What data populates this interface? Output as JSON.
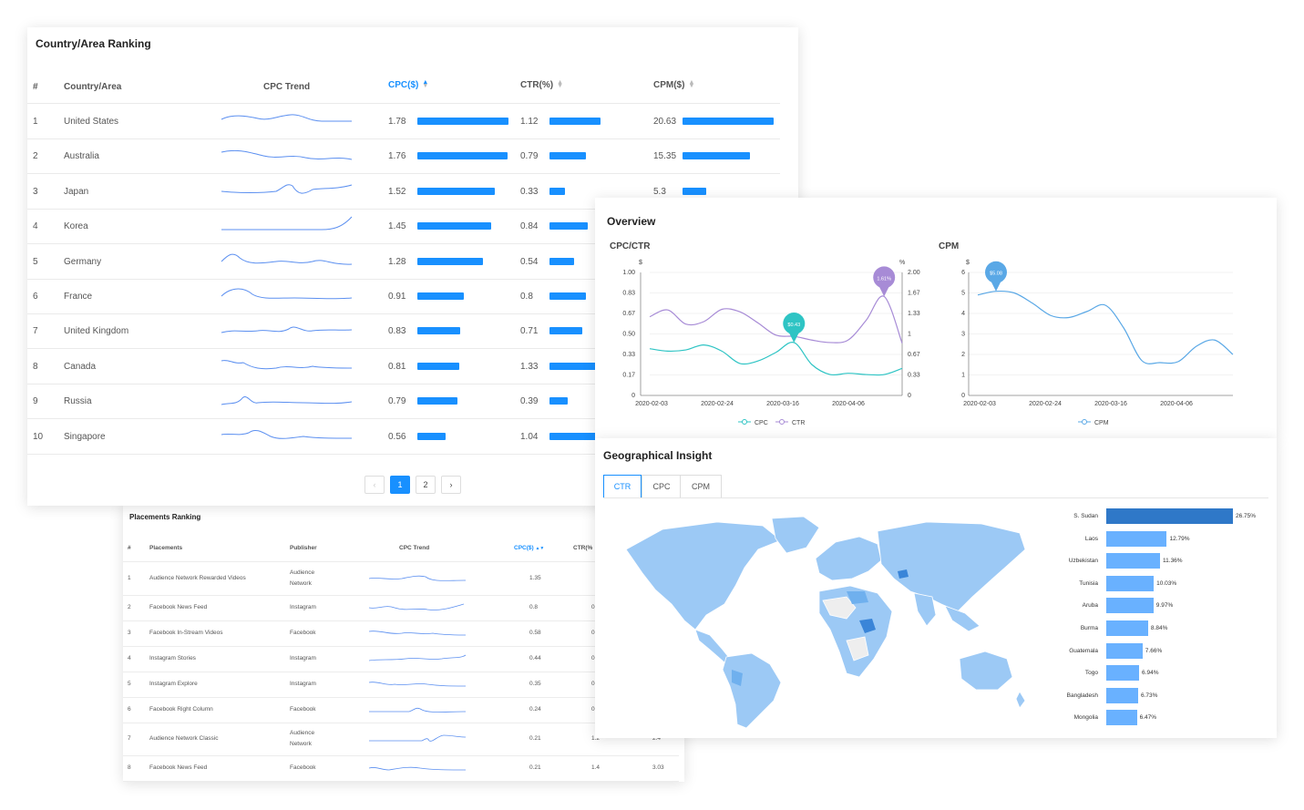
{
  "country_ranking": {
    "title": "Country/Area Ranking",
    "headers": {
      "num": "#",
      "country": "Country/Area",
      "trend": "CPC Trend",
      "cpc": "CPC($)",
      "ctr": "CTR(%)",
      "cpm": "CPM($)"
    },
    "rows": [
      {
        "rank": "1",
        "country": "United States",
        "cpc": "1.78",
        "ctr": "1.12",
        "cpm": "20.63"
      },
      {
        "rank": "2",
        "country": "Australia",
        "cpc": "1.76",
        "ctr": "0.79",
        "cpm": "15.35"
      },
      {
        "rank": "3",
        "country": "Japan",
        "cpc": "1.52",
        "ctr": "0.33",
        "cpm": "5.3"
      },
      {
        "rank": "4",
        "country": "Korea",
        "cpc": "1.45",
        "ctr": "0.84",
        "cpm": ""
      },
      {
        "rank": "5",
        "country": "Germany",
        "cpc": "1.28",
        "ctr": "0.54",
        "cpm": ""
      },
      {
        "rank": "6",
        "country": "France",
        "cpc": "0.91",
        "ctr": "0.8",
        "cpm": ""
      },
      {
        "rank": "7",
        "country": "United Kingdom",
        "cpc": "0.83",
        "ctr": "0.71",
        "cpm": ""
      },
      {
        "rank": "8",
        "country": "Canada",
        "cpc": "0.81",
        "ctr": "1.33",
        "cpm": ""
      },
      {
        "rank": "9",
        "country": "Russia",
        "cpc": "0.79",
        "ctr": "0.39",
        "cpm": ""
      },
      {
        "rank": "10",
        "country": "Singapore",
        "cpc": "0.56",
        "ctr": "1.04",
        "cpm": ""
      }
    ],
    "pagination": {
      "prev": "‹",
      "page1": "1",
      "page2": "2",
      "next": "›"
    }
  },
  "placements_ranking": {
    "title": "Placements Ranking",
    "headers": {
      "num": "#",
      "placement": "Placements",
      "publisher": "Publisher",
      "trend": "CPC Trend",
      "cpc": "CPC($)",
      "ctr": "CTR(%"
    },
    "rows": [
      {
        "rank": "1",
        "placement": "Audience Network Rewarded Videos",
        "publisher": [
          "Audience",
          "Network"
        ],
        "cpc": "1.35",
        "ctr": "",
        "cpm": ""
      },
      {
        "rank": "2",
        "placement": "Facebook News Feed",
        "publisher": [
          "Instagram"
        ],
        "cpc": "0.8",
        "ctr": "0",
        "cpm": ""
      },
      {
        "rank": "3",
        "placement": "Facebook In-Stream Videos",
        "publisher": [
          "Facebook"
        ],
        "cpc": "0.58",
        "ctr": "0",
        "cpm": ""
      },
      {
        "rank": "4",
        "placement": "Instagram Stories",
        "publisher": [
          "Instagram"
        ],
        "cpc": "0.44",
        "ctr": "0",
        "cpm": ""
      },
      {
        "rank": "5",
        "placement": "Instagram Explore",
        "publisher": [
          "Instagram"
        ],
        "cpc": "0.35",
        "ctr": "0",
        "cpm": ""
      },
      {
        "rank": "6",
        "placement": "Facebook Right Column",
        "publisher": [
          "Facebook"
        ],
        "cpc": "0.24",
        "ctr": "0",
        "cpm": ""
      },
      {
        "rank": "7",
        "placement": "Audience Network Classic",
        "publisher": [
          "Audience",
          "Network"
        ],
        "cpc": "0.21",
        "ctr": "1.2",
        "cpm": "2.4"
      },
      {
        "rank": "8",
        "placement": "Facebook News Feed",
        "publisher": [
          "Facebook"
        ],
        "cpc": "0.21",
        "ctr": "1.4",
        "cpm": "3.03"
      }
    ]
  },
  "overview": {
    "title": "Overview",
    "cpc_ctr_title": "CPC/CTR",
    "cpm_title": "CPM",
    "left_unit": "$",
    "right_unit": "%",
    "cpc_marker": "$0.43",
    "ctr_marker": "1.61%",
    "cpm_marker": "$5.08",
    "legend": {
      "cpc": "CPC",
      "ctr": "CTR",
      "cpm": "CPM"
    }
  },
  "chart_data": [
    {
      "type": "line",
      "title": "CPC/CTR",
      "x_ticks": [
        "2020-02-03",
        "2020-02-24",
        "2020-03-16",
        "2020-04-06"
      ],
      "y_left_ticks": [
        "0",
        "0.17",
        "0.33",
        "0.50",
        "0.67",
        "0.83",
        "1.00"
      ],
      "y_right_ticks": [
        "0",
        "0.33",
        "0.67",
        "1",
        "1.33",
        "1.67",
        "2.00"
      ],
      "ylim_left": [
        0,
        1.0
      ],
      "ylim_right": [
        0,
        2.0
      ],
      "x_index": [
        0,
        1,
        2,
        3,
        4,
        5,
        6,
        7,
        8,
        9,
        10,
        11,
        12,
        13,
        14
      ],
      "series": [
        {
          "name": "CPC",
          "axis": "left",
          "color": "#2ec4c4",
          "values": [
            0.38,
            0.36,
            0.37,
            0.41,
            0.36,
            0.26,
            0.28,
            0.35,
            0.43,
            0.25,
            0.17,
            0.18,
            0.17,
            0.17,
            0.22
          ]
        },
        {
          "name": "CTR",
          "axis": "right",
          "color": "#a78bd6",
          "values": [
            1.28,
            1.39,
            1.16,
            1.2,
            1.4,
            1.36,
            1.18,
            0.98,
            0.96,
            0.9,
            0.86,
            0.9,
            1.22,
            1.61,
            0.85
          ]
        }
      ]
    },
    {
      "type": "line",
      "title": "CPM",
      "x_ticks": [
        "2020-02-03",
        "2020-02-24",
        "2020-03-16",
        "2020-04-06"
      ],
      "y_ticks": [
        "0",
        "1",
        "2",
        "3",
        "4",
        "5",
        "6"
      ],
      "ylim": [
        0,
        6
      ],
      "x_index": [
        0,
        1,
        2,
        3,
        4,
        5,
        6,
        7,
        8,
        9,
        10,
        11,
        12,
        13,
        14
      ],
      "series": [
        {
          "name": "CPM",
          "color": "#5aa8e6",
          "values": [
            4.9,
            5.08,
            5.0,
            4.5,
            3.9,
            3.8,
            4.1,
            4.4,
            3.3,
            1.7,
            1.6,
            1.65,
            2.4,
            2.7,
            2.0
          ]
        }
      ]
    },
    {
      "type": "bar",
      "title": "Geographical Insight",
      "categories": [
        "S. Sudan",
        "Laos",
        "Uzbekistan",
        "Tunisia",
        "Aruba",
        "Burma",
        "Guatemala",
        "Togo",
        "Bangladesh",
        "Mongolia"
      ],
      "values": [
        26.75,
        12.79,
        11.36,
        10.03,
        9.97,
        8.84,
        7.66,
        6.94,
        6.73,
        6.47
      ],
      "labels": [
        "26.75%",
        "12.79%",
        "11.36%",
        "10.03%",
        "9.97%",
        "8.84%",
        "7.66%",
        "6.94%",
        "6.73%",
        "6.47%"
      ]
    }
  ],
  "geo": {
    "title": "Geographical Insight",
    "tabs": [
      "CTR",
      "CPC",
      "CPM"
    ],
    "active_tab": "CTR"
  },
  "colors": {
    "accent": "#1890ff",
    "cpc_line": "#2ec4c4",
    "ctr_line": "#a78bd6",
    "cpm_line": "#5aa8e6",
    "map_fill": "#9cc9f5",
    "map_dark": "#3a85d8"
  }
}
